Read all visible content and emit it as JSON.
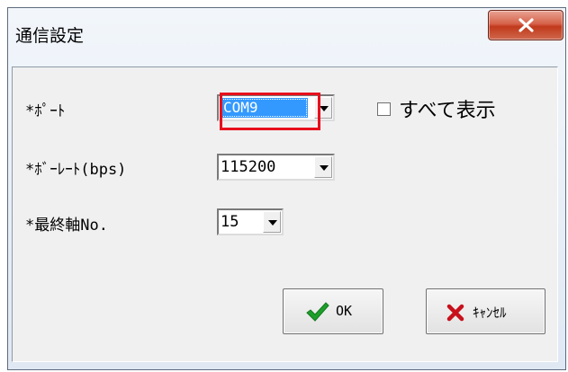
{
  "window": {
    "title": "通信設定"
  },
  "form": {
    "port": {
      "label": "*ﾎﾟｰﾄ",
      "value": "COM9"
    },
    "show_all_checkbox": {
      "label": "すべて表示",
      "checked": false
    },
    "baud": {
      "label": "*ﾎﾞｰﾚｰﾄ(bps)",
      "value": "115200"
    },
    "last_axis": {
      "label": "*最終軸No.",
      "value": "15"
    }
  },
  "buttons": {
    "ok": {
      "label": "OK",
      "icon": "check-icon"
    },
    "cancel": {
      "label": "ｷｬﾝｾﾙ",
      "icon": "x-icon"
    }
  },
  "colors": {
    "selection": "#3399ff",
    "highlight_box": "#e8101c",
    "close_button": "#c1391c",
    "ok_icon": "#1e9e2a",
    "cancel_icon": "#c8101c"
  }
}
